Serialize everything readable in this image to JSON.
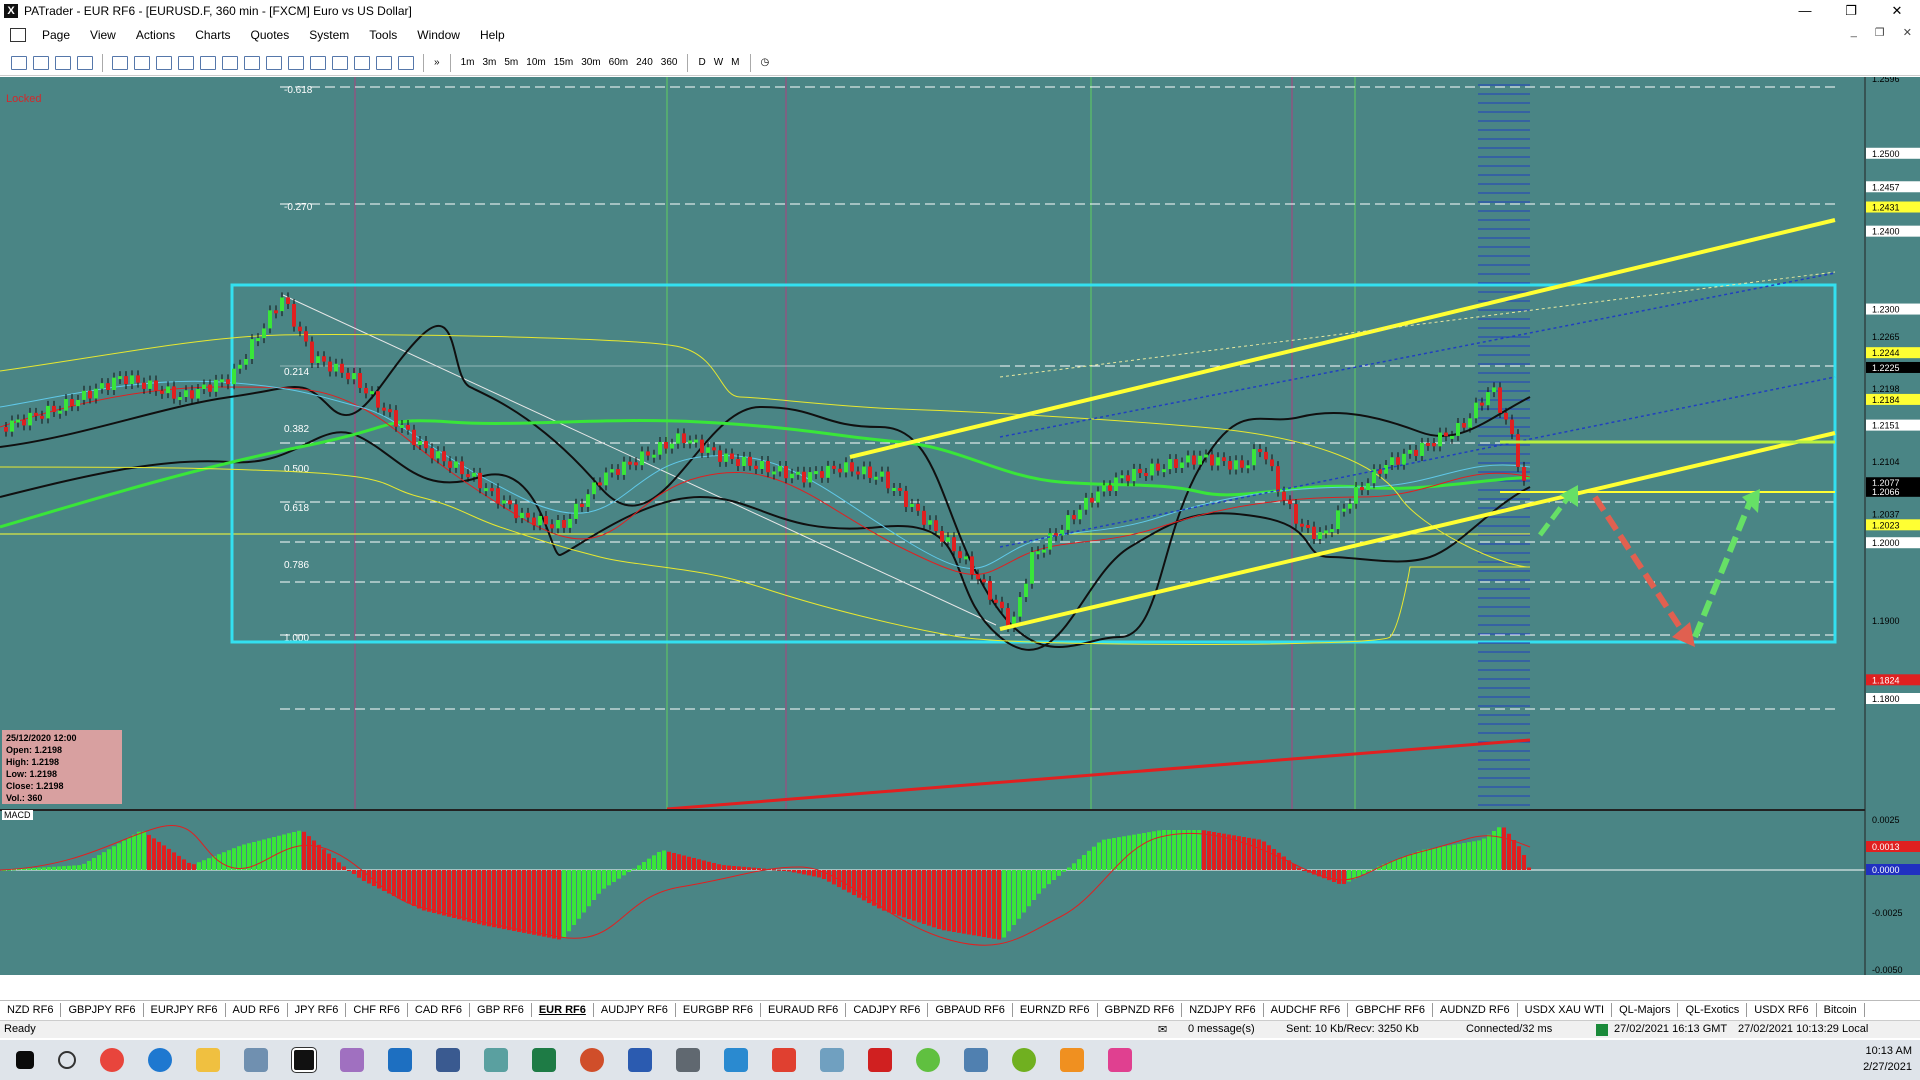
{
  "window": {
    "title": "PATrader - EUR RF6 - [EURUSD.F, 360 min - [FXCM] Euro vs US Dollar]"
  },
  "menu": [
    "Page",
    "View",
    "Actions",
    "Charts",
    "Quotes",
    "System",
    "Tools",
    "Window",
    "Help"
  ],
  "toolbar": {
    "timeframes": [
      "1m",
      "3m",
      "5m",
      "10m",
      "15m",
      "30m",
      "60m",
      "240",
      "360",
      "D",
      "W",
      "M"
    ]
  },
  "chart": {
    "locked_label": "Locked",
    "fib_labels": [
      "-0.618",
      "-0.270",
      "0.214",
      "0.382",
      "0.500",
      "0.618",
      "0.786",
      "1.000"
    ],
    "price_axis": [
      "1.2596",
      "1.2500",
      "1.2457",
      "1.2431",
      "1.2400",
      "1.2300",
      "1.2265",
      "1.2244",
      "1.2225",
      "1.2198",
      "1.2184",
      "1.2151",
      "1.2104",
      "1.2077",
      "1.2066",
      "1.2037",
      "1.2023",
      "1.2000",
      "1.1900",
      "1.1824",
      "1.1800"
    ],
    "info": {
      "date": "25/12/2020 12:00",
      "open": "Open: 1.2198",
      "high": "High: 1.2198",
      "low": "Low: 1.2198",
      "close": "Close: 1.2198",
      "vol": "Vol.: 360"
    },
    "macd_label": "MACD",
    "macd_axis": [
      "0.0025",
      "0.0013",
      "0.0000",
      "-0.0025",
      "-0.0050"
    ],
    "colors": {
      "background": "#4a8585",
      "up": "#39e639",
      "down": "#e02020",
      "channel": "#ffff33",
      "box": "#33e0f0"
    }
  },
  "tabs": [
    "NZD RF6",
    "GBPJPY RF6",
    "EURJPY RF6",
    "AUD RF6",
    "JPY RF6",
    "CHF RF6",
    "CAD RF6",
    "GBP RF6",
    "EUR RF6",
    "AUDJPY RF6",
    "EURGBP RF6",
    "EURAUD RF6",
    "CADJPY RF6",
    "GBPAUD RF6",
    "EURNZD RF6",
    "GBPNZD RF6",
    "NZDJPY RF6",
    "AUDCHF RF6",
    "GBPCHF RF6",
    "AUDNZD RF6",
    "USDX XAU WTI",
    "QL-Majors",
    "QL-Exotics",
    "USDX RF6",
    "Bitcoin"
  ],
  "active_tab": "EUR RF6",
  "status": {
    "ready": "Ready",
    "messages": "0 message(s)",
    "traffic": "Sent: 10 Kb/Recv: 3250 Kb",
    "connection": "Connected/32 ms",
    "gmt": "27/02/2021 16:13 GMT",
    "local": "27/02/2021 10:13:29 Local"
  },
  "taskbar": {
    "time": "10:13 AM",
    "date": "2/27/2021"
  }
}
